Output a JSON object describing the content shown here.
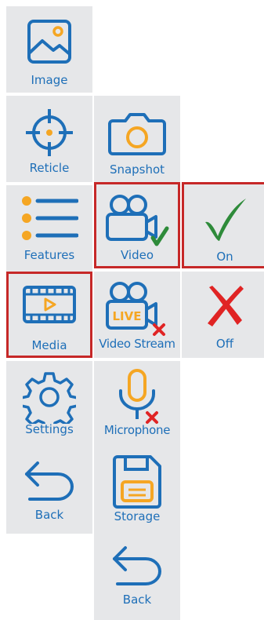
{
  "colors": {
    "tile_bg": "#e6e7e9",
    "icon_blue": "#1e6fb8",
    "accent_orange": "#f5a623",
    "selected_border": "#c62828",
    "check_green": "#2e8b3a",
    "cross_red": "#e02424"
  },
  "menu": {
    "col1": [
      {
        "label": "Image",
        "icon": "image-icon"
      },
      {
        "label": "Reticle",
        "icon": "crosshair-icon"
      },
      {
        "label": "Features",
        "icon": "list-icon"
      },
      {
        "label": "Media",
        "icon": "film-icon",
        "selected": true
      },
      {
        "label": "Settings",
        "icon": "gear-icon"
      },
      {
        "label": "Back",
        "icon": "back-arrow-icon"
      }
    ],
    "col2": [
      {
        "label": "Snapshot",
        "icon": "camera-icon"
      },
      {
        "label": "Video",
        "icon": "video-camera-check-icon",
        "selected": true
      },
      {
        "label": "Video Stream",
        "icon": "live-camera-cross-icon"
      },
      {
        "label": "Microphone",
        "icon": "microphone-cross-icon"
      },
      {
        "label": "Storage",
        "icon": "floppy-disk-icon"
      },
      {
        "label": "Back",
        "icon": "back-arrow-icon"
      }
    ],
    "col3": [
      {
        "label": "On",
        "icon": "checkmark-icon",
        "selected": true
      },
      {
        "label": "Off",
        "icon": "cross-icon"
      }
    ],
    "live_badge": "LIVE"
  }
}
